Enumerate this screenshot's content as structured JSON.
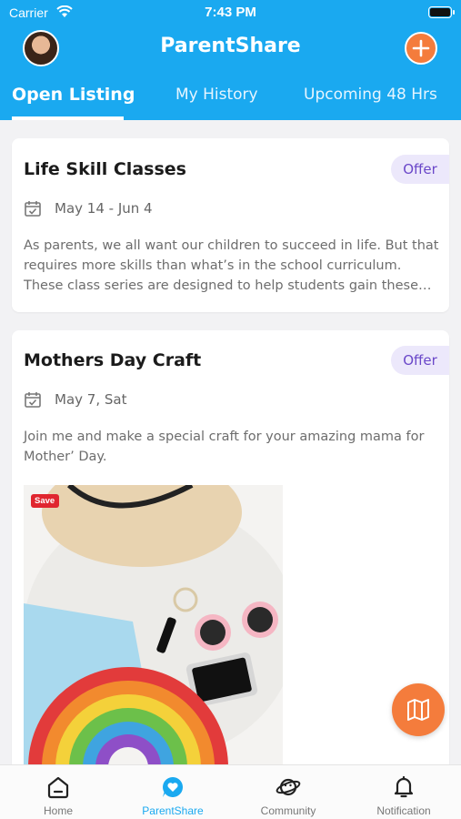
{
  "status": {
    "carrier": "Carrier",
    "time": "7:43 PM"
  },
  "header": {
    "title": "ParentShare",
    "add_icon": "plus-icon",
    "avatar": "user-avatar"
  },
  "tabs": [
    {
      "label": "Open Listing",
      "active": true
    },
    {
      "label": "My History",
      "active": false
    },
    {
      "label": "Upcoming 48 Hrs",
      "active": false
    }
  ],
  "listings": [
    {
      "title": "Life Skill Classes",
      "badge": "Offer",
      "date": "May 14 - Jun 4",
      "description": "As parents, we all want our children to succeed in life. But that requires more skills than what’s in the school curriculum. These class series are designed to help students gain these…"
    },
    {
      "title": "Mothers Day Craft",
      "badge": "Offer",
      "date": "May 7, Sat",
      "description": "Join me and make a special craft for your amazing mama for Mother’ Day.",
      "image_save_label": "Save"
    }
  ],
  "fab": {
    "icon": "map-icon"
  },
  "bottom_nav": [
    {
      "label": "Home",
      "icon": "home-icon",
      "active": false
    },
    {
      "label": "ParentShare",
      "icon": "heart-chat-icon",
      "active": true
    },
    {
      "label": "Community",
      "icon": "planet-icon",
      "active": false
    },
    {
      "label": "Notification",
      "icon": "bell-icon",
      "active": false
    }
  ],
  "colors": {
    "primary": "#1aa9f0",
    "accent": "#f47c3c",
    "badge_bg": "#ece8fb",
    "badge_text": "#6a47c9"
  }
}
